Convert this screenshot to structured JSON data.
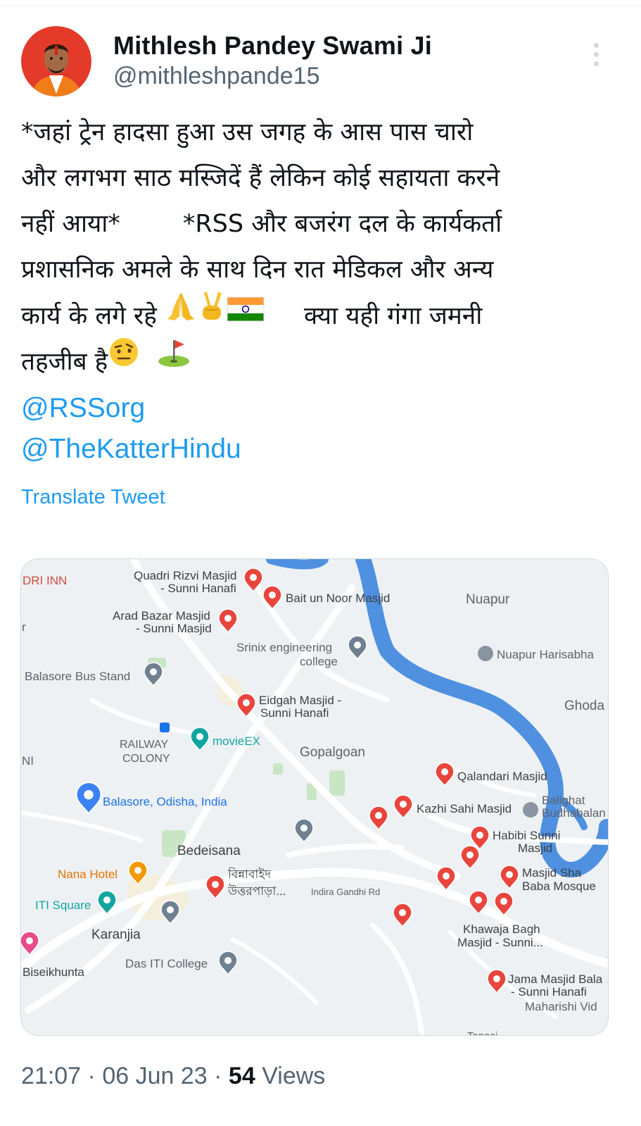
{
  "author": {
    "display_name": "Mithlesh Pandey Swami Ji",
    "handle": "@mithleshpande15"
  },
  "tweet": {
    "lines": [
      "*जहां ट्रेन हादसा हुआ उस जगह के आस पास चारो",
      "और लगभग साठ मस्जिदें हैं लेकिन कोई सहायता करने",
      "नहीं आया*        *RSS और बजरंग दल के कार्यकर्ता",
      "प्रशासनिक अमले के साथ दिन रात मेडिकल और अन्य",
      "कार्य के लगे रहे",
      "तहजीब है"
    ],
    "line5_tail": "क्या यही गंगा जमनी",
    "emoji": [
      "folded-hands",
      "victory-hand",
      "india-flag",
      "face-with-raised-eyebrow",
      "flag-in-hole"
    ],
    "mentions": [
      "@RSSorg",
      "@TheKatterHindu"
    ],
    "translate_label": "Translate Tweet"
  },
  "map": {
    "labels": {
      "dri_inn": "DRI INN",
      "quadri_1": "Quadri Rizvi Masjid",
      "quadri_2": "- Sunni Hanafi",
      "bait": "Bait un Noor Masjid",
      "nuapur": "Nuapur",
      "arad_1": "Arad Bazar Masjid",
      "arad_2": "- Sunni Masjid",
      "srinix_1": "Srinix engineering",
      "srinix_2": "college",
      "nuapur_h": "Nuapur Harisabha",
      "bus_stand": "Balasore Bus Stand",
      "eidgah_1": "Eidgah Masjid -",
      "eidgah_2": "Sunni Hanafi",
      "ghoda": "Ghoda",
      "railway_1": "RAILWAY",
      "railway_2": "COLONY",
      "movieex": "movieEX",
      "gopalgoan": "Gopalgoan",
      "ni": "NI",
      "qalandari": "Qalandari Masjid",
      "balasore": "Balasore, Odisha, India",
      "kazhi": "Kazhi Sahi Masjid",
      "balighat_1": "Balighat",
      "balighat_2": "Budhabalan",
      "habibi_1": "Habibi Sunni",
      "habibi_2": "Masjid",
      "bedeisana": "Bedeisana",
      "nana": "Nana Hotel",
      "bengali_1": "বিন্নাবাইদ",
      "bengali_2": "উত্তরপাড়া...",
      "indira": "Indira Gandhi Rd",
      "sha_1": "Masjid Sha",
      "sha_2": "Baba Mosque",
      "iti_sq": "ITI Square",
      "karanjia": "Karanjia",
      "khawaja_1": "Khawaja Bagh",
      "khawaja_2": "Masjid -  Sunni...",
      "das_iti": "Das ITI College",
      "biseikhunta": "Biseikhunta",
      "jama_1": "Jama Masjid Bala",
      "jama_2": "- Sunni Hanafi",
      "maharishi": "Maharishi Vid",
      "tapasi": "Tapasi"
    },
    "colors": {
      "land": "#eef1f4",
      "water": "#4f90e0",
      "road": "#ffffff",
      "park": "#c8e6c4",
      "pin_red": "#e8453c",
      "pin_blue": "#3b82f6",
      "pin_gray": "#708090",
      "pin_teal": "#12a5a0",
      "pin_orange": "#f29900",
      "pin_pink": "#e84a8a"
    }
  },
  "meta": {
    "time": "21:07",
    "date": "06 Jun 23",
    "views_count": "54",
    "views_label": "Views"
  }
}
